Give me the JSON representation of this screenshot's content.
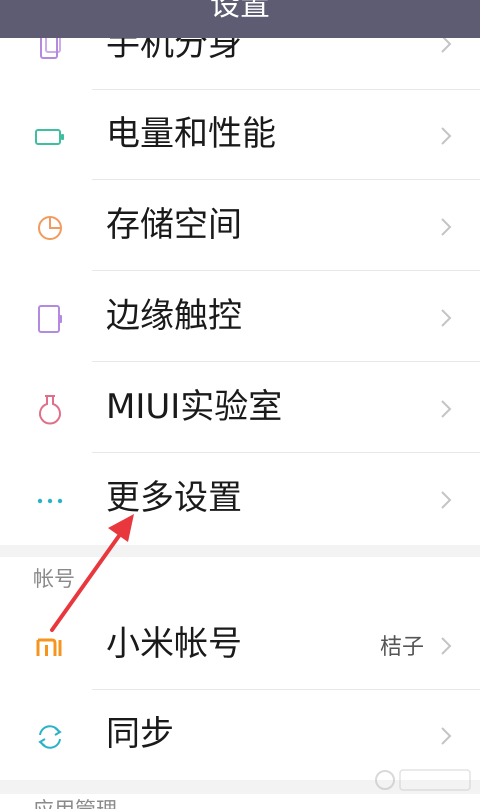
{
  "header": {
    "title": "设置"
  },
  "items": [
    {
      "label": "手机分身",
      "icon": "phone-clone-icon",
      "color": "#b38ae0"
    },
    {
      "label": "电量和性能",
      "icon": "battery-icon",
      "color": "#3fbf9f"
    },
    {
      "label": "存储空间",
      "icon": "storage-pie-icon",
      "color": "#f39a5c"
    },
    {
      "label": "边缘触控",
      "icon": "edge-touch-icon",
      "color": "#b38ae0"
    },
    {
      "label": "MIUI实验室",
      "icon": "flask-icon",
      "color": "#e0708a"
    },
    {
      "label": "更多设置",
      "icon": "more-dots-icon",
      "color": "#2ab3c8"
    }
  ],
  "account_section": {
    "title": "帐号",
    "items": [
      {
        "label": "小米帐号",
        "value": "桔子",
        "icon": "mi-logo-icon",
        "color": "#f7941d"
      },
      {
        "label": "同步",
        "icon": "sync-icon",
        "color": "#2ab3c8"
      }
    ]
  },
  "app_section": {
    "title": "应用管理"
  },
  "colors": {
    "header_bg": "#5d5c73",
    "divider": "#e8e8e8",
    "gap": "#f3f3f3",
    "chevron": "#c4c4c4",
    "arrow": "#e8383d"
  }
}
